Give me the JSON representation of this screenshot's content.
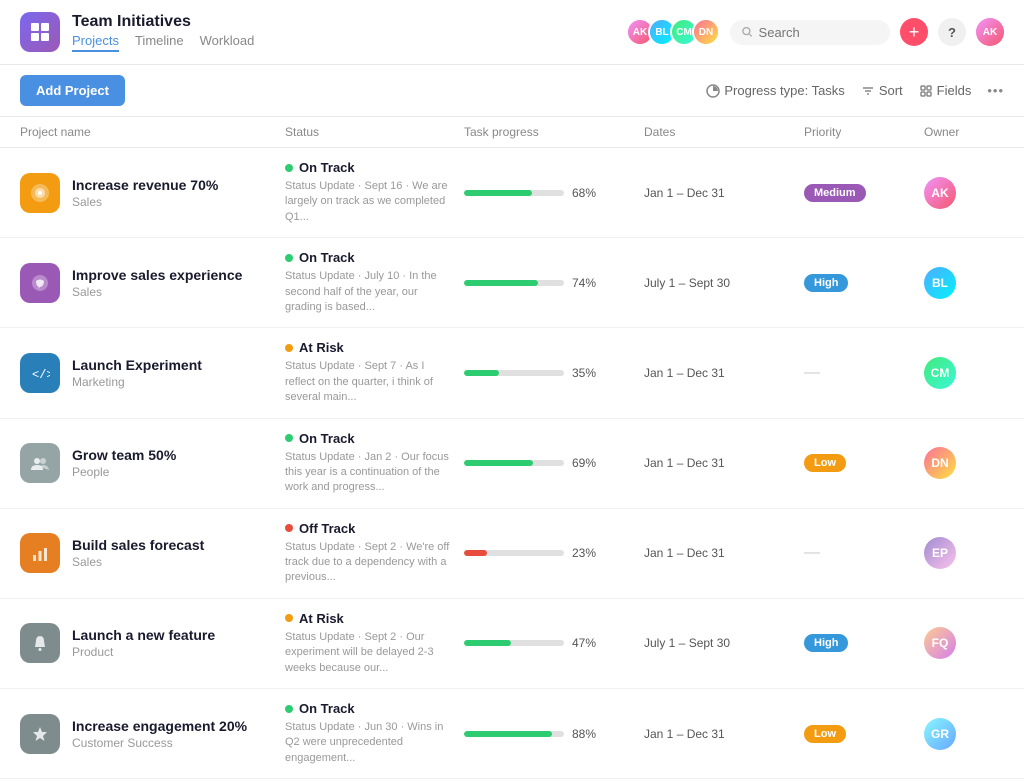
{
  "header": {
    "app_icon": "⊞",
    "title": "Team Initiatives",
    "nav": [
      {
        "label": "Projects",
        "active": true
      },
      {
        "label": "Timeline",
        "active": false
      },
      {
        "label": "Workload",
        "active": false
      }
    ],
    "search_placeholder": "Search",
    "btn_plus": "+",
    "btn_help": "?"
  },
  "toolbar": {
    "add_project_label": "Add Project",
    "progress_type_label": "Progress type: Tasks",
    "sort_label": "Sort",
    "fields_label": "Fields"
  },
  "table": {
    "columns": [
      "Project name",
      "Status",
      "Task progress",
      "Dates",
      "Priority",
      "Owner"
    ],
    "rows": [
      {
        "icon": "🎯",
        "icon_bg": "#f39c12",
        "name": "Increase revenue 70%",
        "dept": "Sales",
        "status": "On Track",
        "status_type": "green",
        "desc": "Status Update · Sept 16 · We are largely on track as we completed Q1...",
        "progress": 68,
        "dates": "Jan 1 – Dec 31",
        "priority": "Medium",
        "priority_class": "priority-medium",
        "owner_class": "av1",
        "owner_initials": "AK"
      },
      {
        "icon": "💬",
        "icon_bg": "#9b59b6",
        "name": "Improve sales experience",
        "dept": "Sales",
        "status": "On Track",
        "status_type": "green",
        "desc": "Status Update · July 10 · In the second half of the year, our grading is based...",
        "progress": 74,
        "dates": "July 1 – Sept 30",
        "priority": "High",
        "priority_class": "priority-high",
        "owner_class": "av2",
        "owner_initials": "BL"
      },
      {
        "icon": "</>",
        "icon_bg": "#2980b9",
        "name": "Launch Experiment",
        "dept": "Marketing",
        "status": "At Risk",
        "status_type": "orange",
        "desc": "Status Update · Sept 7 · As I reflect on the quarter, i think of several main...",
        "progress": 35,
        "dates": "Jan 1 – Dec 31",
        "priority": "—",
        "priority_class": "priority-none",
        "owner_class": "av3",
        "owner_initials": "CM"
      },
      {
        "icon": "👥",
        "icon_bg": "#95a5a6",
        "name": "Grow team 50%",
        "dept": "People",
        "status": "On Track",
        "status_type": "green",
        "desc": "Status Update · Jan 2 · Our focus this year is a continuation of the work and progress...",
        "progress": 69,
        "dates": "Jan 1 – Dec 31",
        "priority": "Low",
        "priority_class": "priority-low",
        "owner_class": "av4",
        "owner_initials": "DN"
      },
      {
        "icon": "📊",
        "icon_bg": "#e67e22",
        "name": "Build sales forecast",
        "dept": "Sales",
        "status": "Off Track",
        "status_type": "red",
        "desc": "Status Update · Sept 2 · We're off track due to a dependency with a previous...",
        "progress": 23,
        "dates": "Jan 1 – Dec 31",
        "priority": "—",
        "priority_class": "priority-none",
        "owner_class": "av5",
        "owner_initials": "EP"
      },
      {
        "icon": "🔔",
        "icon_bg": "#7f8c8d",
        "name": "Launch a new feature",
        "dept": "Product",
        "status": "At Risk",
        "status_type": "orange",
        "desc": "Status Update · Sept 2 · Our experiment will be delayed 2-3 weeks because our...",
        "progress": 47,
        "dates": "July 1 – Sept 30",
        "priority": "High",
        "priority_class": "priority-high",
        "owner_class": "av6",
        "owner_initials": "FQ"
      },
      {
        "icon": "⭐",
        "icon_bg": "#7f8c8d",
        "name": "Increase engagement 20%",
        "dept": "Customer Success",
        "status": "On Track",
        "status_type": "green",
        "desc": "Status Update · Jun 30 · Wins in Q2 were unprecedented engagement...",
        "progress": 88,
        "dates": "Jan 1 – Dec 31",
        "priority": "Low",
        "priority_class": "priority-low",
        "owner_class": "av7",
        "owner_initials": "GR"
      }
    ]
  }
}
